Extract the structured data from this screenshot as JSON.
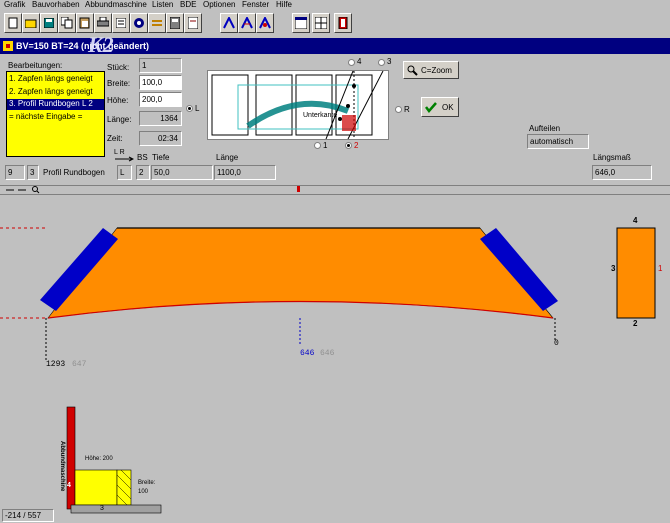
{
  "menu": [
    "Grafik",
    "Bauvorhaben",
    "Abbundmaschine",
    "Listen",
    "BDE",
    "Optionen",
    "Fenster",
    "Hilfe"
  ],
  "toolbar_icons": [
    "new-icon",
    "open-icon",
    "save-icon",
    "copy-icon",
    "paste-icon",
    "print-icon",
    "list-icon",
    "compass-icon",
    "lines-icon",
    "calc-icon",
    "card-icon",
    "tools-icon",
    "tools-b-icon",
    "tools-c-icon",
    "window-icon",
    "grid-icon",
    "exit-icon"
  ],
  "title": "BV=150  BT=24 (nicht geändert)",
  "watermark": "K2",
  "bearbeitungen": {
    "label": "Bearbeitungen:",
    "items": [
      "1. Zapfen längs geneigt",
      "2. Zapfen längs geneigt",
      "3. Profil Rundbogen L 2",
      "= nächste Eingabe ="
    ],
    "selected_index": 2
  },
  "fields": {
    "stueck_label": "Stück:",
    "stueck": "1",
    "breite_label": "Breite:",
    "breite": "100,0",
    "hoehe_label": "Höhe:",
    "hoehe": "200,0",
    "laenge_label": "Länge:",
    "laenge": "1364",
    "zeit_label": "Zeit:",
    "zeit": "02:34"
  },
  "radios": {
    "L": "L",
    "R": "R",
    "r1": "1",
    "r2": "2",
    "r3": "3",
    "r4": "4"
  },
  "preview_label": "Unterkante",
  "zoom_label": "C=Zoom",
  "ok_label": "OK",
  "aufteilen_label": "Aufteilen",
  "aufteilen_value": "automatisch",
  "bottom_row": {
    "num1": "9",
    "num2": "3",
    "name": "Profil Rundbogen",
    "lr_label": "L   R",
    "lr_value": "L",
    "bs_label": "BS",
    "bs_value": "2",
    "tiefe_label": "Tiefe",
    "tiefe_value": "50,0",
    "laenge_label": "Länge",
    "laenge_value": "1100,0",
    "laengsmass_label": "Längsmaß",
    "laengsmass_value": "646,0"
  },
  "drawing": {
    "dim_left": "1293",
    "dim_left_grey": "647",
    "dim_mid": "646",
    "dim_mid_grey": "646",
    "dim_right": "0",
    "side_top": "4",
    "side_bottom": "2",
    "side_left": "3",
    "side_right": "1",
    "xsec_vertical": "Abbundmaschine",
    "xsec_height": "Höhe: 200",
    "xsec_width_label": "Breite:",
    "xsec_width": "100",
    "xsec_left": "4",
    "xsec_bottom": "3",
    "status": "-214 / 557"
  },
  "colors": {
    "orange": "#ff8c00",
    "blue": "#0000c8",
    "titlebar": "#000080",
    "yellow": "#ffff00",
    "red": "#d00000"
  }
}
